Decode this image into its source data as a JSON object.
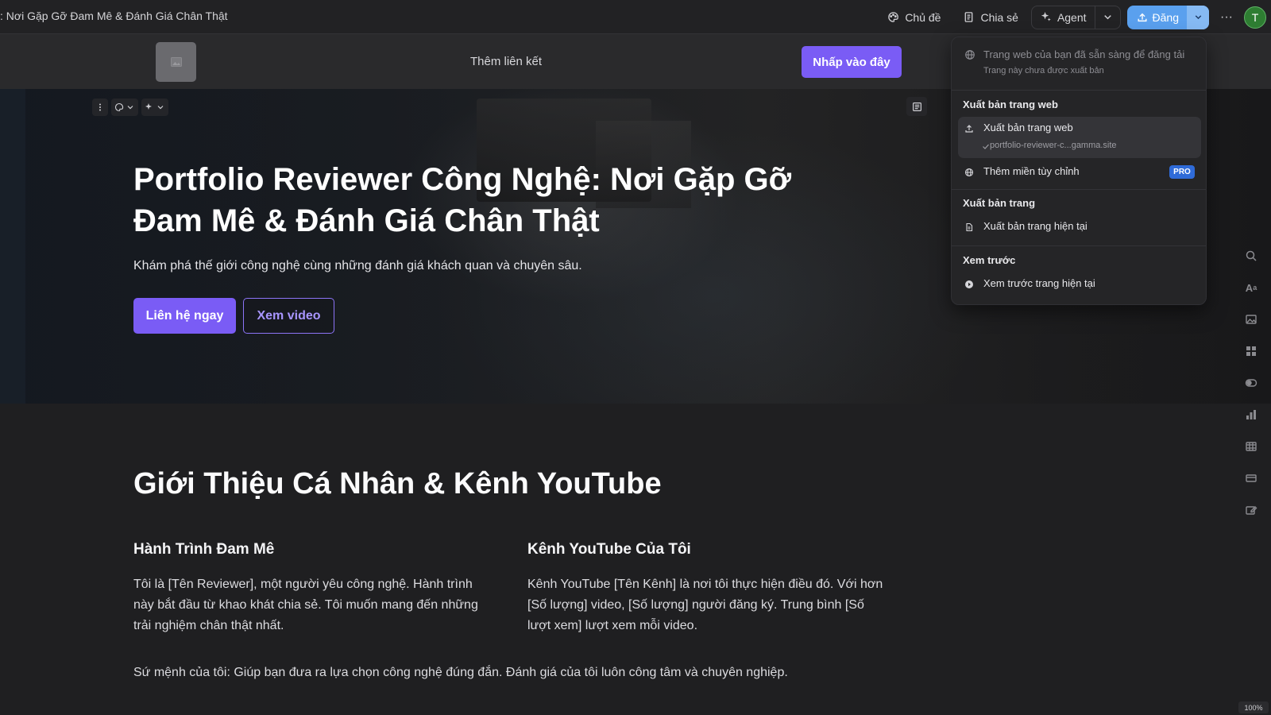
{
  "document": {
    "title": ": Nơi Gặp Gỡ Đam Mê & Đánh Giá Chân Thật"
  },
  "toolbar": {
    "theme_label": "Chủ đề",
    "share_label": "Chia sẻ",
    "agent_label": "Agent",
    "publish_label": "Đăng",
    "more_label": "···",
    "avatar_initial": "T",
    "publish_color": "#5aa0ee"
  },
  "nav": {
    "add_link_label": "Thêm liên kết",
    "cta_label": "Nhấp vào đây",
    "cta_color": "#7a5cf5"
  },
  "hero": {
    "title": "Portfolio Reviewer Công Nghệ: Nơi Gặp Gỡ Đam Mê & Đánh Giá Chân Thật",
    "subtitle": "Khám phá thế giới công nghệ cùng những đánh giá khách quan và chuyên sâu.",
    "primary_button": "Liên hệ ngay",
    "secondary_button": "Xem video"
  },
  "intro": {
    "section_title": "Giới Thiệu Cá Nhân & Kênh YouTube",
    "left_heading": "Hành Trình Đam Mê",
    "left_text": "Tôi là [Tên Reviewer], một người yêu công nghệ. Hành trình này bắt đầu từ khao khát chia sẻ. Tôi muốn mang đến những trải nghiệm chân thật nhất.",
    "right_heading": "Kênh YouTube Của Tôi",
    "right_text": "Kênh YouTube [Tên Kênh] là nơi tôi thực hiện điều đó. Với hơn [Số lượng] video, [Số lượng] người đăng ký. Trung bình [Số lượt xem] lượt xem mỗi video.",
    "mission": "Sứ mệnh của tôi: Giúp bạn đưa ra lựa chọn công nghệ đúng đắn. Đánh giá của tôi luôn công tâm và chuyên nghiệp."
  },
  "publish_menu": {
    "status_title": "Trang web của bạn đã sẵn sàng để đăng tải",
    "status_sub": "Trang này chưa được xuất bản",
    "section_web": "Xuất bản trang web",
    "item_publish_web": "Xuất bản trang web",
    "item_publish_web_url": "portfolio-reviewer-c...gamma.site",
    "item_custom_domain": "Thêm miền tùy chỉnh",
    "pro_badge": "PRO",
    "section_page": "Xuất bản trang",
    "item_publish_page": "Xuất bản trang hiện tại",
    "section_preview": "Xem trước",
    "item_preview": "Xem trước trang hiện tại"
  },
  "status": {
    "zoom": "100%"
  }
}
